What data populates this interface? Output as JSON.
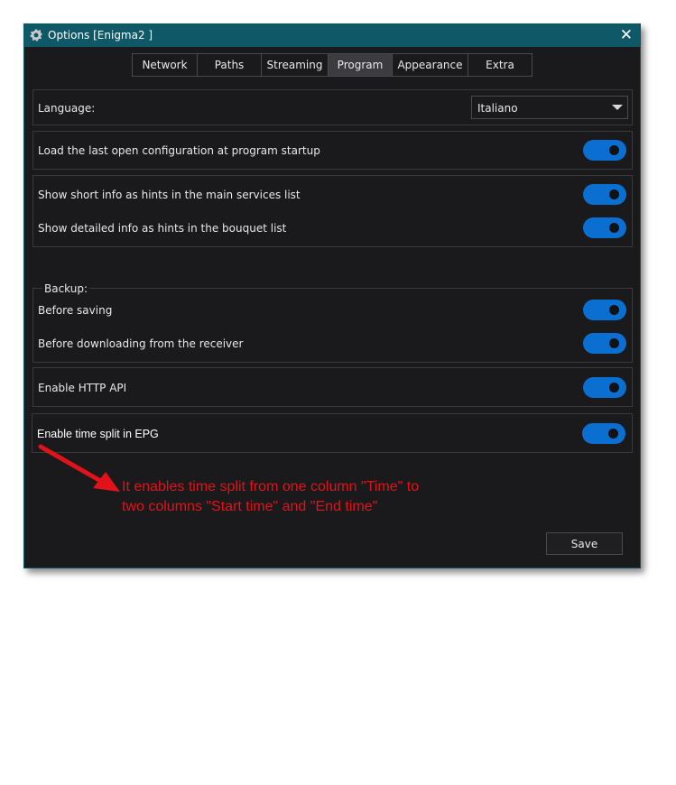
{
  "window": {
    "title": "Options [Enigma2 ]",
    "close_glyph": "✕"
  },
  "tabs": [
    {
      "label": "Network"
    },
    {
      "label": "Paths"
    },
    {
      "label": "Streaming"
    },
    {
      "label": "Program",
      "active": true
    },
    {
      "label": "Appearance"
    },
    {
      "label": "Extra"
    }
  ],
  "language": {
    "label": "Language:",
    "value": "Italiano"
  },
  "settings": {
    "load_last_config": {
      "label": "Load the last open configuration at program startup",
      "enabled": true
    },
    "short_info_hints": {
      "label": "Show short info as hints in the main services list",
      "enabled": true
    },
    "detailed_info_hints": {
      "label": "Show detailed info as hints in the bouquet list",
      "enabled": true
    },
    "backup": {
      "title": "Backup:",
      "before_saving": {
        "label": "Before saving",
        "enabled": true
      },
      "before_downloading": {
        "label": "Before downloading from the receiver",
        "enabled": true
      }
    },
    "http_api": {
      "label": "Enable HTTP API",
      "enabled": true
    },
    "time_split_epg": {
      "label": "Enable time split in EPG",
      "enabled": true
    }
  },
  "annotation": {
    "line1": "It enables time split from one column \"Time\" to",
    "line2": "two columns \"Start time\" and \"End time\"",
    "color": "#e0131a"
  },
  "buttons": {
    "save": "Save"
  },
  "colors": {
    "titlebar": "#0f5868",
    "toggle_on": "#0a6fd0",
    "background": "#1a1a1c"
  },
  "icons": {
    "app": "enigma2-gear-icon",
    "close": "close-icon",
    "dropdown": "chevron-down-icon",
    "annotation_arrow": "arrow-icon"
  }
}
